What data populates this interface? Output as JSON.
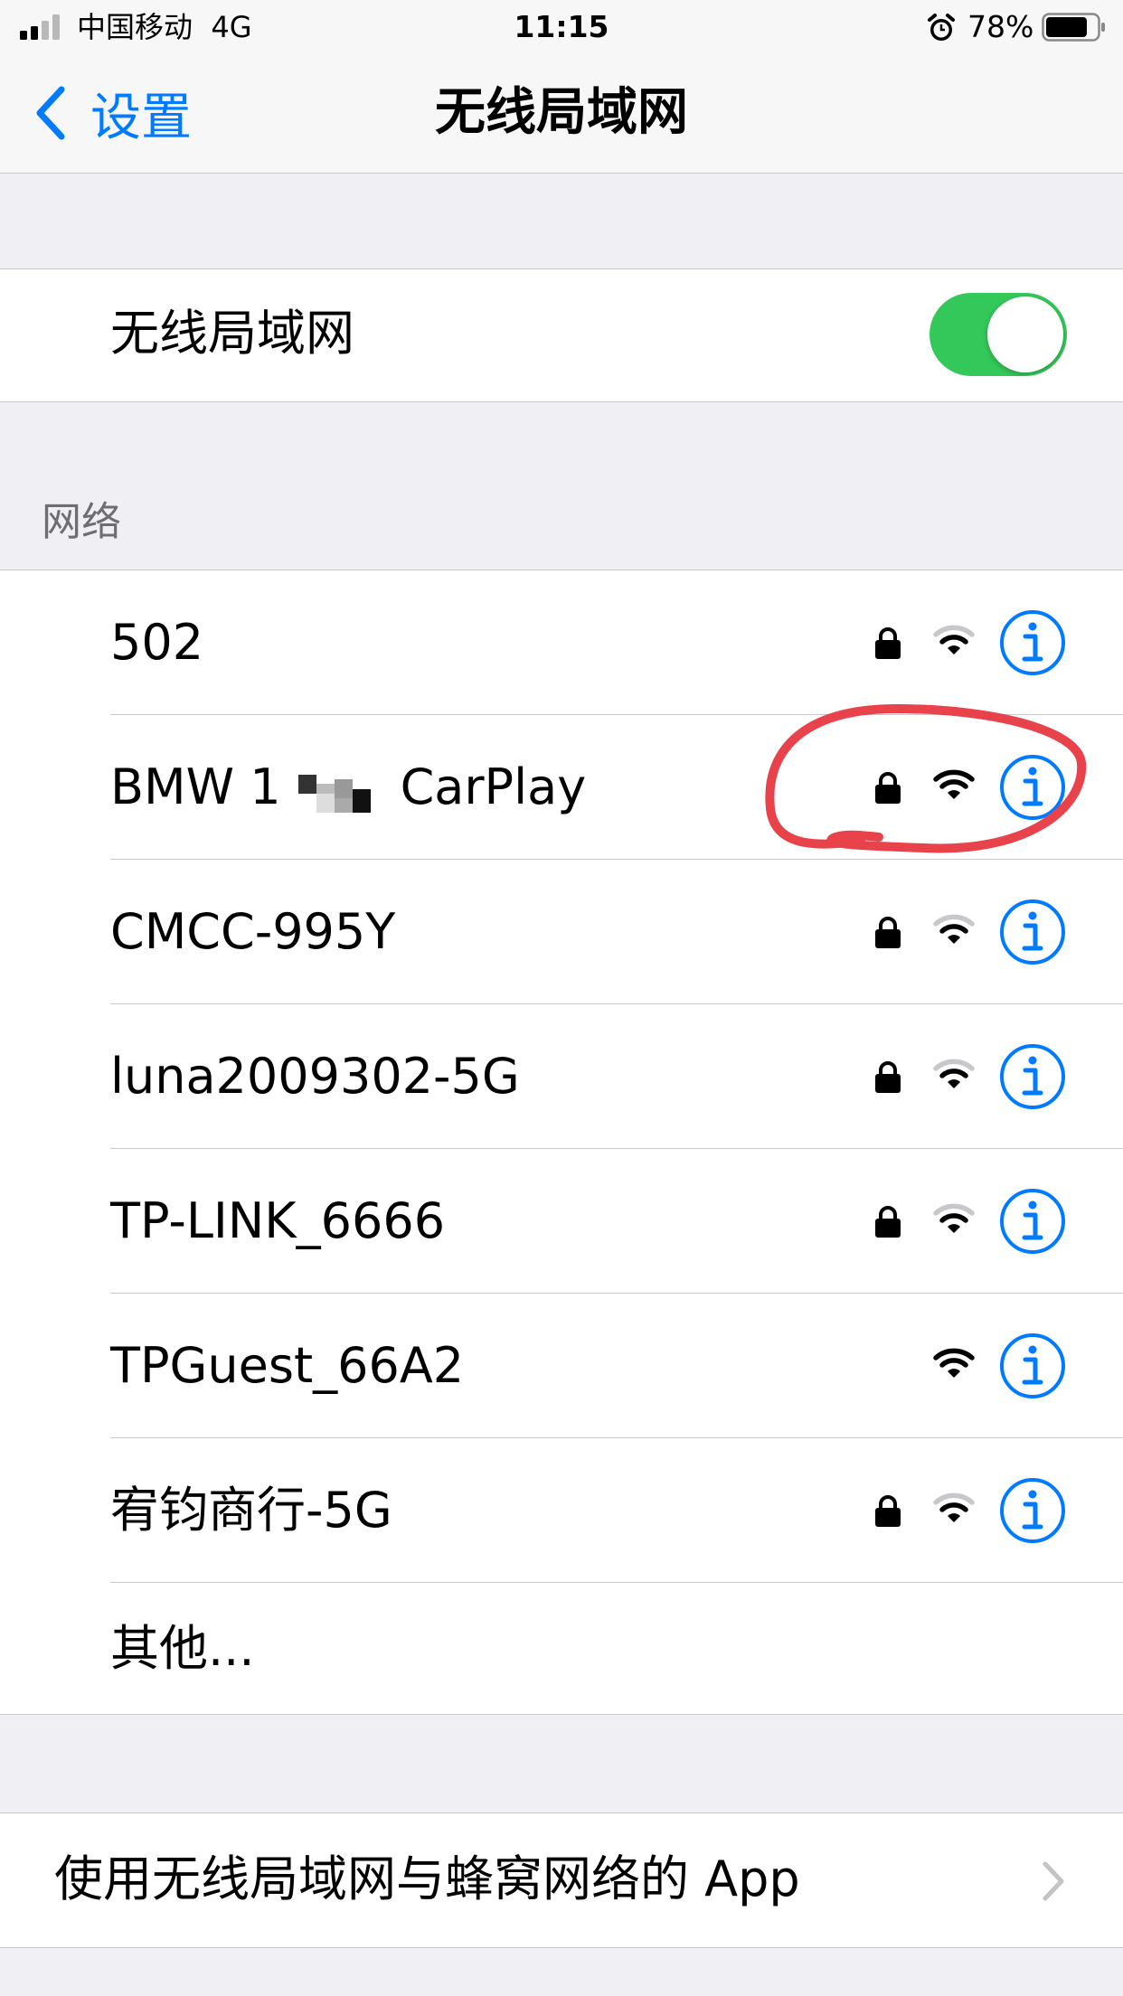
{
  "status_bar": {
    "carrier": "中国移动",
    "network": "4G",
    "time": "11:15",
    "battery_percent": "78%"
  },
  "nav": {
    "back_label": "设置",
    "title": "无线局域网"
  },
  "wifi_toggle": {
    "label": "无线局域网",
    "on": true,
    "on_color": "#34c759"
  },
  "networks": {
    "header": "网络",
    "items": [
      {
        "name": "502",
        "secured": true,
        "signal": "medium"
      },
      {
        "name": "BMW 1 [redacted] CarPlay",
        "name_prefix": "BMW 1",
        "name_suffix": "CarPlay",
        "secured": true,
        "signal": "full"
      },
      {
        "name": "CMCC-995Y",
        "secured": true,
        "signal": "medium"
      },
      {
        "name": "luna2009302-5G",
        "secured": true,
        "signal": "medium"
      },
      {
        "name": "TP-LINK_6666",
        "secured": true,
        "signal": "medium"
      },
      {
        "name": "TPGuest_66A2",
        "secured": false,
        "signal": "full"
      },
      {
        "name": "宥钧商行-5G",
        "secured": true,
        "signal": "medium"
      }
    ],
    "other_label": "其他..."
  },
  "apps_row": {
    "label": "使用无线局域网与蜂窝网络的 App"
  },
  "colors": {
    "accent": "#007aff",
    "annotation": "#e8424b"
  },
  "icons": {
    "secured": "lock-icon",
    "signal": "wifi-icon",
    "details": "info-icon",
    "back": "chevron-left-icon",
    "disclosure": "chevron-right-icon"
  }
}
